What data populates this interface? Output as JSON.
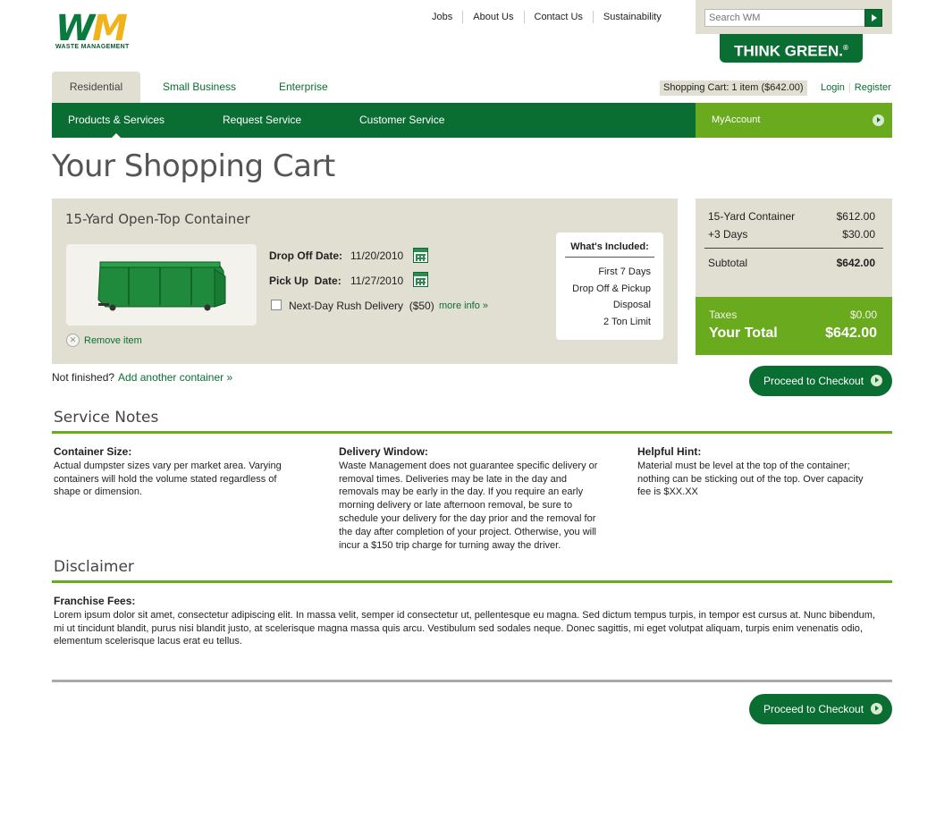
{
  "brand": {
    "logo_w": "W",
    "logo_m": "M",
    "logo_sub": "WASTE MANAGEMENT",
    "tagline": "THINK GREEN.",
    "tagline_mark": "®"
  },
  "top_links": [
    "Jobs",
    "About Us",
    "Contact Us",
    "Sustainability"
  ],
  "search": {
    "placeholder": "Search WM"
  },
  "segments": [
    "Residential",
    "Small Business",
    "Enterprise"
  ],
  "cart_summary": "Shopping Cart: 1 item ($642.00)",
  "auth": {
    "login": "Login",
    "register": "Register"
  },
  "nav": [
    "Products & Services",
    "Request Service",
    "Customer Service"
  ],
  "my_account": "MyAccount",
  "page_title": "Your Shopping Cart",
  "cart_item": {
    "title": "15-Yard Open-Top Container",
    "remove": "Remove item",
    "dropoff_label": "Drop Off Date:",
    "dropoff_value": "11/20/2010",
    "pickup_label": "Pick Up  Date:",
    "pickup_value": "11/27/2010",
    "rush_label": "Next-Day Rush Delivery  ($50)",
    "more_info": "more info »",
    "included_title": "What's Included:",
    "included": [
      "First 7 Days",
      "Drop Off & Pickup",
      "Disposal",
      "2 Ton Limit"
    ]
  },
  "summary": {
    "rows": [
      {
        "label": "15-Yard Container",
        "value": "$612.00"
      },
      {
        "label": "+3 Days",
        "value": "$30.00"
      }
    ],
    "subtotal_label": "Subtotal",
    "subtotal_value": "$642.00",
    "taxes_label": "Taxes",
    "taxes_value": "$0.00",
    "total_label": "Your Total",
    "total_value": "$642.00"
  },
  "checkout_label": "Proceed to Checkout",
  "not_finished": "Not finished?",
  "add_another": "Add another container »",
  "service_notes": {
    "title": "Service Notes",
    "columns": [
      {
        "heading": "Container Size:",
        "text": "Actual dumpster sizes vary per market area. Varying containers will hold the volume stated regardless of shape or dimension."
      },
      {
        "heading": "Delivery Window:",
        "text": "Waste Management does not guarantee specific delivery or removal times. Deliveries may be late in the day and removals may be early in the day. If you require an early morning delivery or late afternoon removal, be sure to schedule your delivery for the day prior and the removal for the day after completion of your project. Otherwise, you will incur a $150 trip charge for turning away the driver."
      },
      {
        "heading": "Helpful Hint:",
        "text": "Material must be level at the top of the container; nothing can be sticking out of the top. Over capacity fee is $XX.XX"
      }
    ]
  },
  "disclaimer": {
    "title": "Disclaimer",
    "heading": "Franchise Fees:",
    "text": "Lorem ipsum dolor sit amet, consectetur adipiscing elit. In massa velit, semper id consectetur ut, pellentesque eu magna. Sed dictum tempus turpis, in tempor est cursus at. Nunc bibendum, mi ut tincidunt blandit, purus nisi blandit justo, at scelerisque magna massa quis arcu. Vestibulum sed sodales neque. Donec sagittis, mi eget volutpat aliquam, turpis enim venenatis odio, elementum scelerisque lacus erat eu tellus."
  },
  "colors": {
    "brand_green": "#0a6e33",
    "accent_green": "#6aaa1f",
    "logo_yellow": "#f2b21b",
    "panel_beige": "#e1ded2"
  }
}
